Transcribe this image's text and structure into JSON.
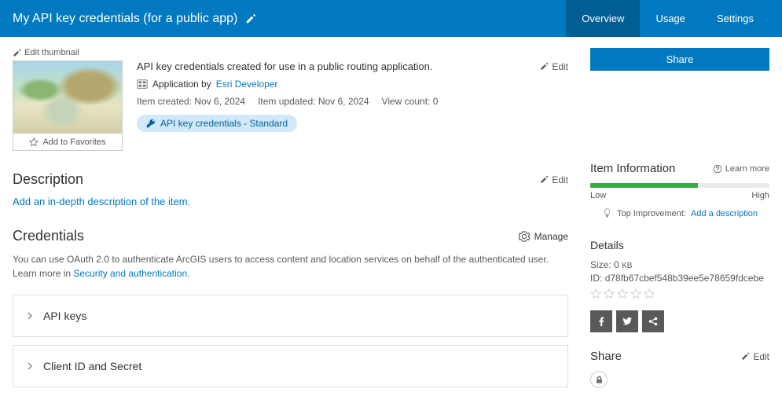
{
  "header": {
    "title": "My API key credentials (for a public app)",
    "tabs": [
      {
        "label": "Overview",
        "active": true
      },
      {
        "label": "Usage",
        "active": false
      },
      {
        "label": "Settings",
        "active": false
      }
    ]
  },
  "actions": {
    "share_button": "Share",
    "edit_thumbnail": "Edit thumbnail",
    "add_to_favorites": "Add to Favorites",
    "edit": "Edit",
    "manage": "Manage",
    "learn_more": "Learn more"
  },
  "info": {
    "summary": "API key credentials created for use in a public routing application.",
    "application_by": "Application by",
    "author": "Esri Developer",
    "created_label": "Item created:",
    "created_date": "Nov 6, 2024",
    "updated_label": "Item updated:",
    "updated_date": "Nov 6, 2024",
    "view_count_label": "View count:",
    "view_count": "0",
    "badge": "API key credentials - Standard"
  },
  "description": {
    "title": "Description",
    "placeholder": "Add an in-depth description of the item."
  },
  "credentials": {
    "title": "Credentials",
    "text_prefix": "You can use OAuth 2.0 to authenticate ArcGIS users to access content and location services on behalf of the authenticated user. Learn more in ",
    "link_text": "Security and authentication",
    "text_suffix": ".",
    "items": [
      {
        "label": "API keys"
      },
      {
        "label": "Client ID and Secret"
      }
    ]
  },
  "item_info": {
    "title": "Item Information",
    "progress_percent": 60,
    "low_label": "Low",
    "high_label": "High",
    "tip_label": "Top Improvement:",
    "tip_link": "Add a description"
  },
  "details": {
    "title": "Details",
    "size_label": "Size:",
    "size_value": "0",
    "size_unit": "KB",
    "id_label": "ID:",
    "id_value": "d78fb67cbef548b39ee5e78659fdcebe"
  },
  "share_section": {
    "title": "Share"
  }
}
